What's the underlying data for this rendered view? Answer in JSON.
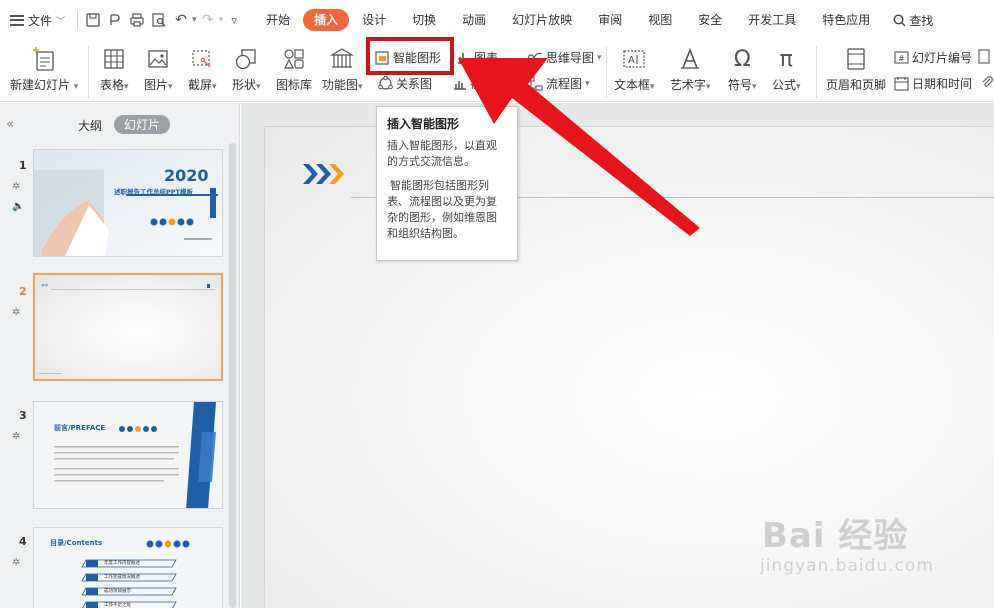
{
  "menu": {
    "file_label": "文件",
    "tabs": [
      {
        "label": "开始",
        "active": false
      },
      {
        "label": "插入",
        "active": true
      },
      {
        "label": "设计",
        "active": false
      },
      {
        "label": "切换",
        "active": false
      },
      {
        "label": "动画",
        "active": false
      },
      {
        "label": "幻灯片放映",
        "active": false
      },
      {
        "label": "审阅",
        "active": false
      },
      {
        "label": "视图",
        "active": false
      },
      {
        "label": "安全",
        "active": false
      },
      {
        "label": "开发工具",
        "active": false
      },
      {
        "label": "特色应用",
        "active": false
      }
    ],
    "search_label": "查找"
  },
  "ribbon": {
    "new_slide": "新建幻灯片",
    "table": "表格",
    "picture": "图片",
    "screenshot": "截屏",
    "shape": "形状",
    "icon_library": "图标库",
    "function_chart": "功能图",
    "smart_art": "智能图形",
    "relation_chart": "关系图",
    "chart": "图表",
    "online_chart": "在线图表",
    "mind_map": "思维导图",
    "flowchart": "流程图",
    "textbox": "文本框",
    "wordart": "艺术字",
    "symbol": "符号",
    "formula": "公式",
    "header_footer": "页眉和页脚",
    "slide_number": "幻灯片编号",
    "date_time": "日期和时间"
  },
  "left_panel": {
    "tab_outline": "大纲",
    "tab_slides": "幻灯片",
    "slides": [
      {
        "num": "1",
        "title_year": "2020",
        "title": "述职报告工作总结PPT模板"
      },
      {
        "num": "2"
      },
      {
        "num": "3",
        "title": "前言/PREFACE"
      },
      {
        "num": "4",
        "title": "目录/Contents",
        "items": [
          "年度工作内容概述",
          "工作完成情况概述",
          "成功项目展示",
          "工作不足之处"
        ]
      }
    ]
  },
  "tooltip": {
    "title": "插入智能图形",
    "line1": "插入智能图形，以直观的方式交流信息。",
    "line2": "智能图形包括图形列表、流程图以及更为复杂的图形，例如维恩图和组织结构图。"
  },
  "watermark": {
    "brand": "Bai 经验",
    "url": "jingyan.baidu.com"
  },
  "colors": {
    "accent": "#f0683b",
    "highlight_box": "#c8161d",
    "arrow": "#e8141c",
    "slide_blue": "#1e5fa8",
    "slide_orange": "#f0a020"
  }
}
